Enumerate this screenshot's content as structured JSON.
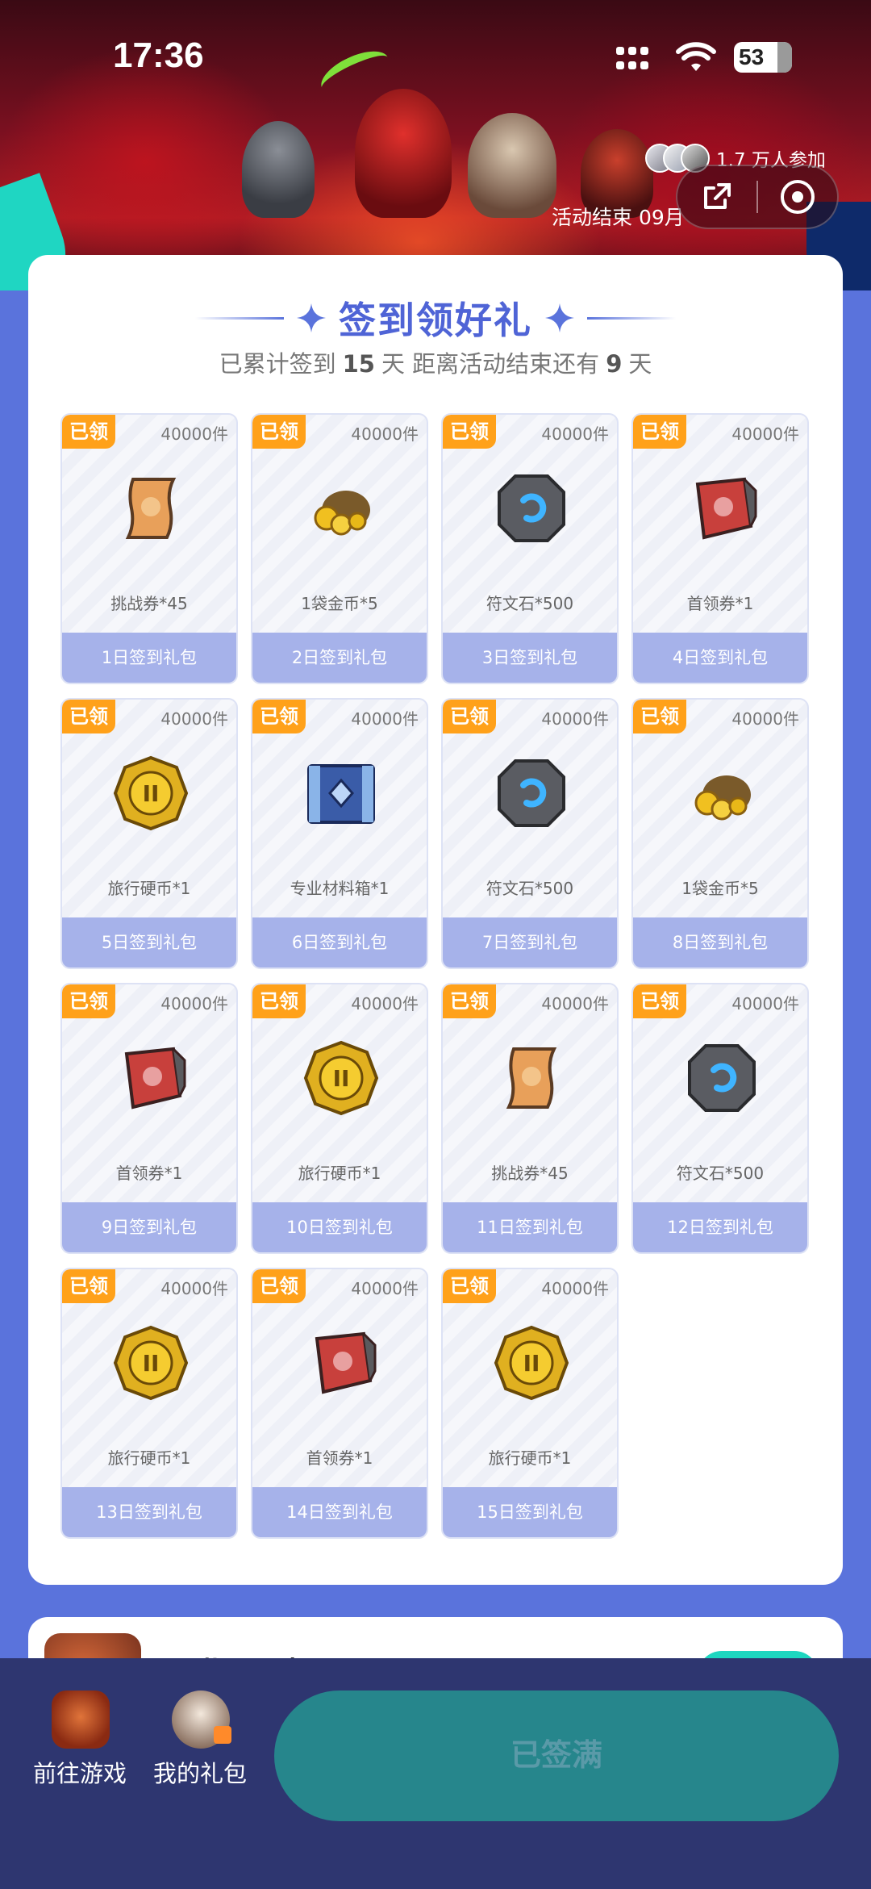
{
  "status_bar": {
    "time": "17:36",
    "battery": "53"
  },
  "banner": {
    "participants": "1.7 万人参加",
    "activity_end": "活动结束 09月"
  },
  "checkin": {
    "title": "签到领好礼",
    "summary_prefix": "已累计签到",
    "days_signed": "15",
    "summary_mid": "天  距离活动结束还有",
    "days_left": "9",
    "summary_suffix": "天"
  },
  "gifts": [
    {
      "badge": "已领",
      "stock": "40000件",
      "item": "挑战券*45",
      "icon": "scroll-icon",
      "label": "1日签到礼包"
    },
    {
      "badge": "已领",
      "stock": "40000件",
      "item": "1袋金币*5",
      "icon": "gold-bag-icon",
      "label": "2日签到礼包"
    },
    {
      "badge": "已领",
      "stock": "40000件",
      "item": "符文石*500",
      "icon": "rune-stone-icon",
      "label": "3日签到礼包"
    },
    {
      "badge": "已领",
      "stock": "40000件",
      "item": "首领券*1",
      "icon": "boss-ticket-icon",
      "label": "4日签到礼包"
    },
    {
      "badge": "已领",
      "stock": "40000件",
      "item": "旅行硬币*1",
      "icon": "travel-coin-icon",
      "label": "5日签到礼包"
    },
    {
      "badge": "已领",
      "stock": "40000件",
      "item": "专业材料箱*1",
      "icon": "material-chest-icon",
      "label": "6日签到礼包"
    },
    {
      "badge": "已领",
      "stock": "40000件",
      "item": "符文石*500",
      "icon": "rune-stone-icon",
      "label": "7日签到礼包"
    },
    {
      "badge": "已领",
      "stock": "40000件",
      "item": "1袋金币*5",
      "icon": "gold-bag-icon",
      "label": "8日签到礼包"
    },
    {
      "badge": "已领",
      "stock": "40000件",
      "item": "首领券*1",
      "icon": "boss-ticket-icon",
      "label": "9日签到礼包"
    },
    {
      "badge": "已领",
      "stock": "40000件",
      "item": "旅行硬币*1",
      "icon": "travel-coin-icon",
      "label": "10日签到礼包"
    },
    {
      "badge": "已领",
      "stock": "40000件",
      "item": "挑战券*45",
      "icon": "scroll-icon",
      "label": "11日签到礼包"
    },
    {
      "badge": "已领",
      "stock": "40000件",
      "item": "符文石*500",
      "icon": "rune-stone-icon",
      "label": "12日签到礼包"
    },
    {
      "badge": "已领",
      "stock": "40000件",
      "item": "旅行硬币*1",
      "icon": "travel-coin-icon",
      "label": "13日签到礼包"
    },
    {
      "badge": "已领",
      "stock": "40000件",
      "item": "首领券*1",
      "icon": "boss-ticket-icon",
      "label": "14日签到礼包"
    },
    {
      "badge": "已领",
      "stock": "40000件",
      "item": "旅行硬币*1",
      "icon": "travel-coin-icon",
      "label": "15日签到礼包"
    }
  ],
  "game_card": {
    "name": "异世界勇者"
  },
  "bottom_bar": {
    "go_game": "前往游戏",
    "my_gifts": "我的礼包",
    "signed_full": "已签满"
  },
  "colors": {
    "accent": "#5a73dc",
    "badge": "#ffa11a",
    "footer": "#a6b2ea",
    "button": "#26868c",
    "bottom_bar": "#2e3670"
  }
}
